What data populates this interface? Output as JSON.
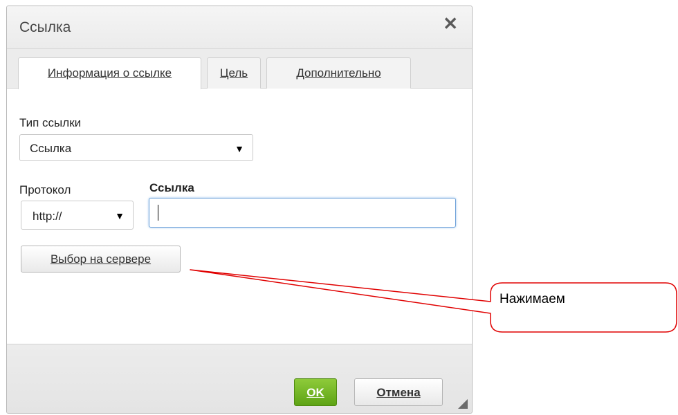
{
  "dialog": {
    "title": "Ссылка",
    "close_glyph": "✕",
    "close_icon": "close-icon"
  },
  "tabs": [
    {
      "label": "Информация о ссылке",
      "active": true
    },
    {
      "label": "Цель",
      "active": false
    },
    {
      "label": "Дополнительно",
      "active": false
    }
  ],
  "link_type": {
    "label": "Тип ссылки",
    "value": "Ссылка"
  },
  "protocol": {
    "label": "Протокол",
    "value": "http://"
  },
  "url": {
    "label": "Ссылка",
    "value": ""
  },
  "server_button": {
    "label": "Выбор на сервере"
  },
  "footer": {
    "ok_label": "OK",
    "cancel_label": "Отмена"
  },
  "annotation": {
    "text": "Нажимаем",
    "color": "#e00000"
  },
  "colors": {
    "ok_green": "#6fb522",
    "focus_blue": "#6a9fd8"
  }
}
